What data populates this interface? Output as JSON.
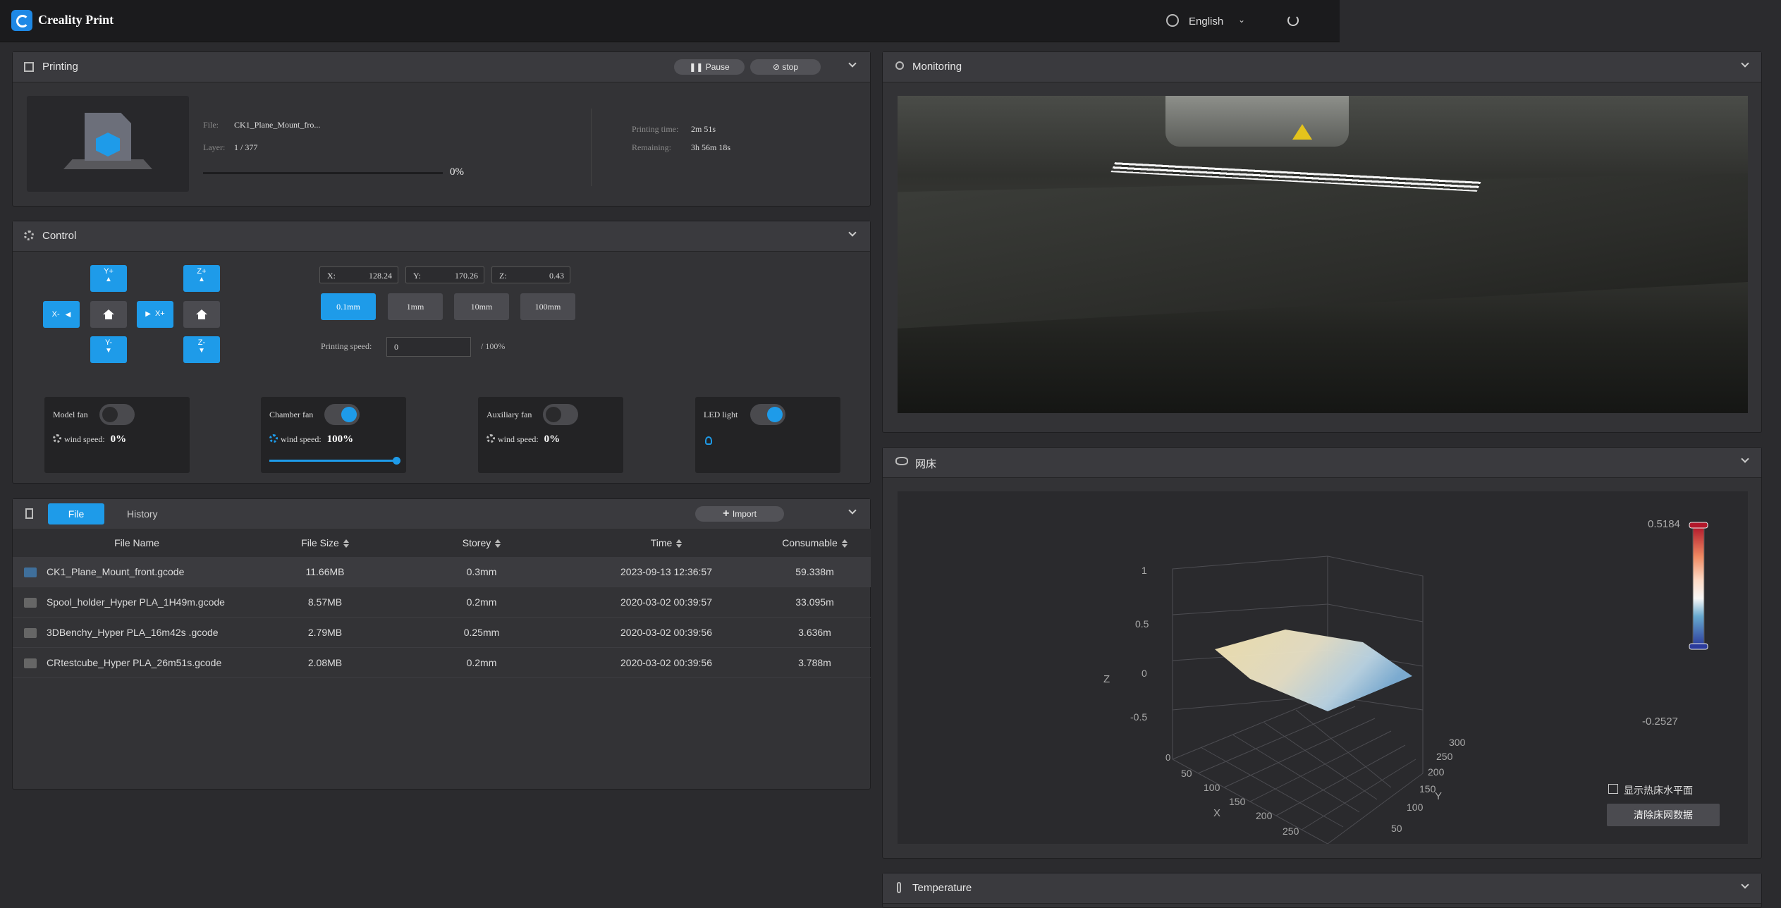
{
  "app": {
    "title": "Creality Print",
    "language": "English"
  },
  "printing": {
    "title": "Printing",
    "pause_label": "Pause",
    "stop_label": "stop",
    "file_label": "File:",
    "file_value": "CK1_Plane_Mount_fro...",
    "layer_label": "Layer:",
    "layer_value": "1 / 377",
    "progress_text": "0%",
    "progress_fraction": 0,
    "time_label": "Printing time:",
    "time_value": "2m 51s",
    "remaining_label": "Remaining:",
    "remaining_value": "3h 56m 18s"
  },
  "control": {
    "title": "Control",
    "jog": {
      "y_plus": "Y+",
      "y_minus": "Y-",
      "x_plus": "X+",
      "x_minus": "X-",
      "z_plus": "Z+",
      "z_minus": "Z-"
    },
    "x_label": "X:",
    "x_value": "128.24",
    "y_label": "Y:",
    "y_value": "170.26",
    "z_label": "Z:",
    "z_value": "0.43",
    "steps": [
      "0.1mm",
      "1mm",
      "10mm",
      "100mm"
    ],
    "active_step": "0.1mm",
    "speed_label": "Printing speed:",
    "speed_value": "0",
    "speed_suffix": "/ 100%",
    "fans": {
      "model": {
        "label": "Model fan",
        "wind_label": "wind speed:",
        "speed": "0%",
        "on": false
      },
      "chamber": {
        "label": "Chamber fan",
        "wind_label": "wind speed:",
        "speed": "100%",
        "on": true,
        "slider_fraction": 1.0
      },
      "aux": {
        "label": "Auxiliary fan",
        "wind_label": "wind speed:",
        "speed": "0%",
        "on": false
      },
      "led": {
        "label": "LED light",
        "on": true
      }
    }
  },
  "files": {
    "tab_file": "File",
    "tab_history": "History",
    "import_label": "Import",
    "columns": [
      "File Name",
      "File Size",
      "Storey",
      "Time",
      "Consumable"
    ],
    "rows": [
      {
        "name": "CK1_Plane_Mount_front.gcode",
        "size": "11.66MB",
        "storey": "0.3mm",
        "time": "2023-09-13 12:36:57",
        "consumable": "59.338m"
      },
      {
        "name": "Spool_holder_Hyper PLA_1H49m.gcode",
        "size": "8.57MB",
        "storey": "0.2mm",
        "time": "2020-03-02 00:39:57",
        "consumable": "33.095m"
      },
      {
        "name": "3DBenchy_Hyper PLA_16m42s .gcode",
        "size": "2.79MB",
        "storey": "0.25mm",
        "time": "2020-03-02 00:39:56",
        "consumable": "3.636m"
      },
      {
        "name": "CRtestcube_Hyper PLA_26m51s.gcode",
        "size": "2.08MB",
        "storey": "0.2mm",
        "time": "2020-03-02 00:39:56",
        "consumable": "3.788m"
      }
    ]
  },
  "monitoring": {
    "title": "Monitoring"
  },
  "mesh": {
    "title": "网床",
    "show_plane_label": "显示热床水平面",
    "clear_label": "清除床网数据",
    "colorbar_max": "0.5184",
    "colorbar_min": "-0.2527",
    "z_ticks": [
      "1",
      "0.5",
      "0",
      "-0.5"
    ],
    "z_axis_label": "Z",
    "x_ticks": [
      "0",
      "50",
      "100",
      "150",
      "200",
      "250"
    ],
    "x_axis_label": "X",
    "y_ticks": [
      "50",
      "100",
      "150",
      "200",
      "250",
      "300"
    ],
    "y_axis_label": "Y"
  },
  "temperature": {
    "title": "Temperature"
  }
}
